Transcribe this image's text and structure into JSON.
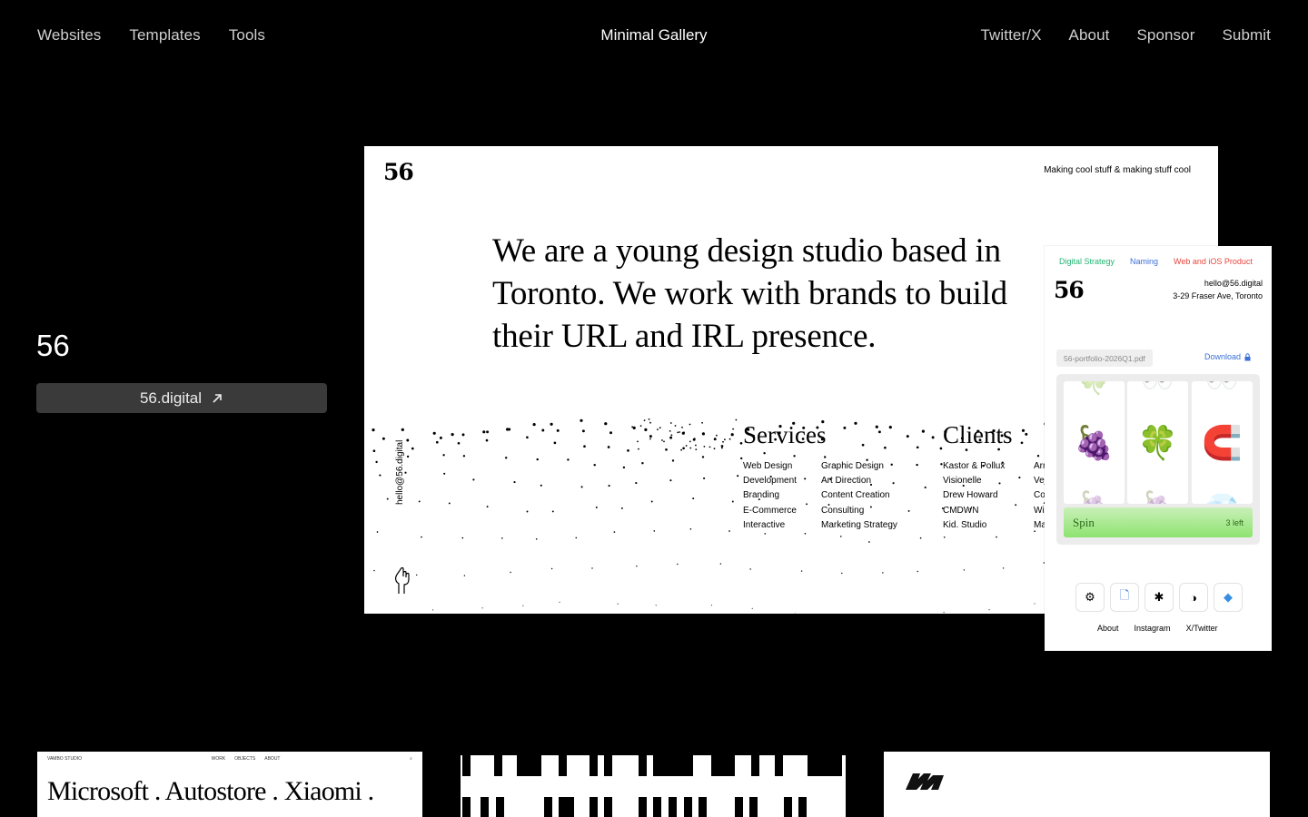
{
  "nav": {
    "left": [
      "Websites",
      "Templates",
      "Tools"
    ],
    "brand": "Minimal Gallery",
    "right": [
      "Twitter/X",
      "About",
      "Sponsor",
      "Submit"
    ]
  },
  "site": {
    "title": "56",
    "link_label": "56.digital"
  },
  "desktop_preview": {
    "logo": "56",
    "tagline": "Making cool stuff & making stuff cool",
    "headline": "We are a young design studio based in Toronto. We work with brands to build their URL and IRL presence.",
    "email": "hello@56.digital",
    "services_heading": "Services",
    "services_col1": [
      "Web Design",
      "Development",
      "Branding",
      "E-Commerce",
      "Interactive"
    ],
    "services_col2": [
      "Graphic Design",
      "Art Direction",
      "Content Creation",
      "Consulting",
      "Marketing Strategy"
    ],
    "clients_heading": "Clients",
    "clients_col1": [
      "Kastor & Pollux",
      "Visionelle",
      "Drew Howard",
      "CMDWN",
      "Kid. Studio"
    ],
    "clients_col2": [
      "Arr",
      "Vej",
      "Co",
      "Wi",
      "Ma"
    ]
  },
  "mobile_preview": {
    "tabs": [
      {
        "label": "Digital Strategy",
        "color": "#22b573"
      },
      {
        "label": "Naming",
        "color": "#3a6fd8"
      },
      {
        "label": "Web and iOS Product",
        "color": "#e8453c"
      }
    ],
    "logo": "56",
    "email": "hello@56.digital",
    "address": "3-29 Fraser Ave, Toronto",
    "file": "56-portfolio-2026Q1.pdf",
    "download": "Download",
    "reels": [
      "🍇",
      "🍀",
      "🧲"
    ],
    "spin_label": "Spin",
    "spins_left": "3 left",
    "links": [
      "About",
      "Instagram",
      "X/Twitter"
    ]
  },
  "cards": {
    "card1": {
      "studio": "VAMBO STUDIO",
      "menu": [
        "WORK",
        "OBJECTS",
        "ABOUT"
      ],
      "text": "Microsoft . Autostore . Xiaomi ."
    }
  }
}
